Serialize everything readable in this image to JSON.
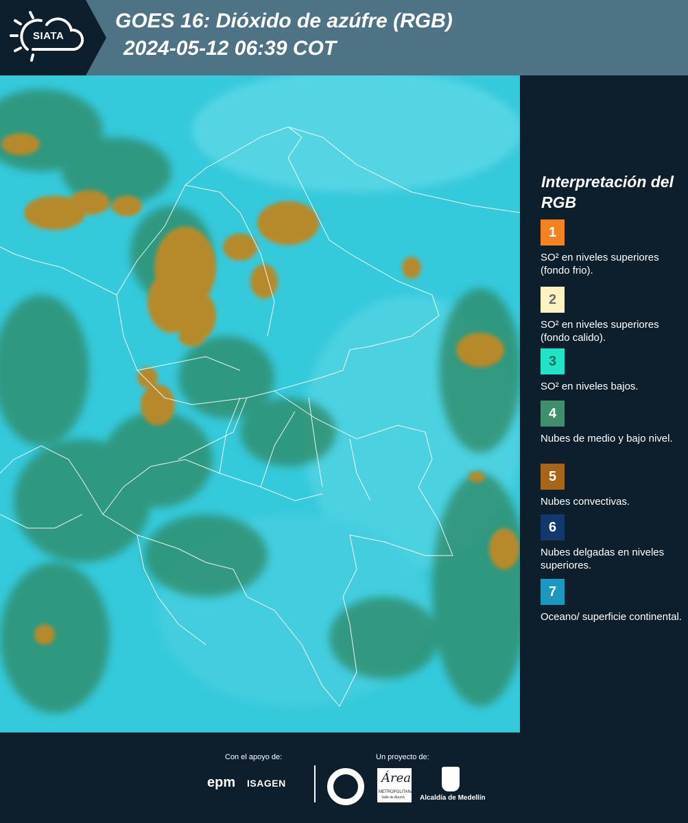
{
  "header": {
    "logo": "SIATA",
    "title_line1": "GOES 16: Dióxido de azúfre (RGB)",
    "title_line2": "2024-05-12 06:39 COT"
  },
  "map": {
    "background_color": "#35c9dc",
    "convective_color": "#b68a2a",
    "low_cloud_color": "#2f8c6a",
    "border_color": "#ffffff"
  },
  "legend": {
    "title": "Interpretación del RGB",
    "items": [
      {
        "number": "1",
        "color": "#f58220",
        "text_color": "#ffffff",
        "description": "SO² en niveles superiores (fondo frio)."
      },
      {
        "number": "2",
        "color": "#fdf2c0",
        "text_color": "#6b6b6b",
        "description": "SO² en niveles superiores (fondo calido)."
      },
      {
        "number": "3",
        "color": "#21e3c6",
        "text_color": "#1b6c66",
        "description": "SO² en niveles bajos."
      },
      {
        "number": "4",
        "color": "#3f8f6e",
        "text_color": "#ffffff",
        "description": "Nubes de medio y bajo nivel."
      },
      {
        "number": "5",
        "color": "#a8651a",
        "text_color": "#ffffff",
        "description": "Nubes convectivas."
      },
      {
        "number": "6",
        "color": "#12386e",
        "text_color": "#ffffff",
        "description": "Nubes delgadas en niveles superiores."
      },
      {
        "number": "7",
        "color": "#1c97bf",
        "text_color": "#ffffff",
        "description": "Oceano/ superficie continental."
      }
    ]
  },
  "footer": {
    "support_label": "Con el apoyo de:",
    "project_label": "Un proyecto de:",
    "sponsors": [
      "epm",
      "ISAGEN"
    ],
    "area_logo_name": "Área",
    "area_logo_sub": "METROPOLITANA",
    "area_logo_sub2": "Valle de Aburrá",
    "alcaldia": "Alcaldía de Medellín"
  }
}
